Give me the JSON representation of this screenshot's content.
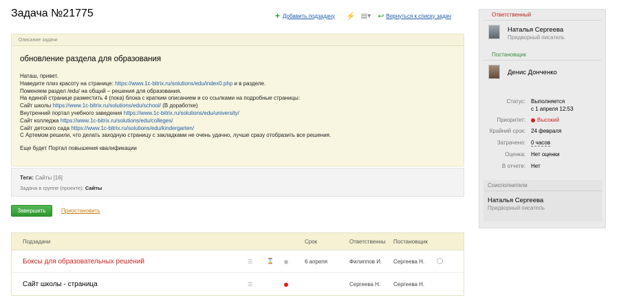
{
  "task": {
    "title": "Задача №21775"
  },
  "actions": {
    "add_subtask": "Добавить подзадачу",
    "back_to_list": "Вернуться к списку задач"
  },
  "description": {
    "label": "Описание задачи",
    "heading": "обновление раздела для образования",
    "greeting": "Наташ, привет.",
    "line1_pre": "Наведите плиз красоту на странице: ",
    "line1_link": "https://www.1c-bitrix.ru/solutions/edu/index0.php",
    "line1_post": " и в разделе.",
    "line2": "Поменяем раздел /edu/ на общий – решения для образования.",
    "line3": "На единой странице разместить 4 (пока) блока с кратким описанием и со ссылками на подробные страницы:",
    "school_pre": "Сайт школы ",
    "school_link": "https://www.1c-bitrix.ru/solutions/edu/school/",
    "school_post": " (В доработке)",
    "univ_pre": "Внутренний портал учебного заведения ",
    "univ_link": "https://www.1c-bitrix.ru/solutions/edu/university/",
    "college_pre": "Сайт колледжа ",
    "college_link": "https://www.1c-bitrix.ru/solutions/edu/colleges/",
    "kinder_pre": "Сайт детского сада ",
    "kinder_link": "https://www.1c-bitrix.ru/solutions/edu/kindergarten/",
    "note": " С Артемом решили, что делать заходную страницу с закладками не очень удачно, лучше сразу отобразить все решения.",
    "portal": " Еще будет Портал повышения квалификации"
  },
  "tags": {
    "label": "Теги:",
    "value": "Сайты [16]",
    "group_label": "Задача в группе (проекте):",
    "group_value": "Сайты"
  },
  "buttons": {
    "finish": "Завершить",
    "pause": "Приостановить"
  },
  "subtasks": {
    "headers": {
      "title": "Подзадачи",
      "deadline": "Срок",
      "responsible": "Ответственны",
      "creator": "Постановщик"
    },
    "rows": [
      {
        "title": "Боксы для образовательных решений",
        "deadline": "6 апреля",
        "responsible": "Филиппов И.",
        "creator": "Сергеева Н."
      },
      {
        "title": "Сайт школы - страница",
        "deadline": "",
        "responsible": "Сергеева Н.",
        "creator": "Сергеева Н."
      }
    ]
  },
  "sidebar": {
    "responsible": {
      "label": "Ответственный",
      "name": "Наталья Сергеева",
      "role": "Придворный писатель"
    },
    "creator": {
      "label": "Постановщик",
      "name": "Денис Донченко"
    },
    "props": {
      "status_k": "Статус:",
      "status_v": "Выполняется",
      "status_since": "с 1 апреля 12:53",
      "priority_k": "Приоритет:",
      "priority_v": "Высокий",
      "deadline_k": "Крайний срок:",
      "deadline_v": "24 февраля",
      "spent_k": "Затрачено:",
      "spent_v": "0 часов",
      "rating_k": "Оценка:",
      "rating_v": "Нет оценки",
      "report_k": "В отчете:",
      "report_v": "Нет"
    },
    "coexecutors": {
      "label": "Соисполнители",
      "name": "Наталья Сергеева",
      "role": "Придворный писатель"
    }
  },
  "colors": {
    "accent_green": "#2f962f",
    "link": "#1e5aa8",
    "high_priority": "#d62020"
  }
}
